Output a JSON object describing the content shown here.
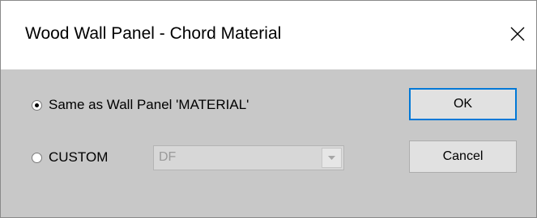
{
  "window": {
    "title": "Wood Wall Panel - Chord Material",
    "close_icon": "close-icon"
  },
  "options": {
    "same_as_label": "Same as Wall Panel 'MATERIAL'",
    "same_as_selected": true,
    "custom_label": "CUSTOM",
    "custom_selected": false
  },
  "custom_material": {
    "selected_value": "DF",
    "enabled": false,
    "arrow_icon": "chevron-down-icon"
  },
  "buttons": {
    "ok_label": "OK",
    "cancel_label": "Cancel"
  },
  "colors": {
    "dialog_background": "#c8c8c8",
    "title_background": "#ffffff",
    "default_button_border": "#0078d7",
    "disabled_text": "#9a9a9a"
  }
}
